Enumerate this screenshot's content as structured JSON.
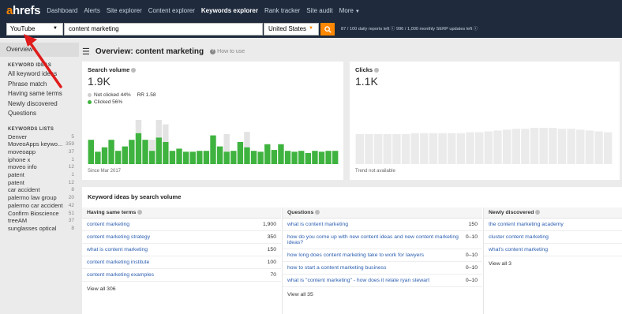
{
  "nav": {
    "logo_a": "a",
    "logo_rest": "hrefs",
    "items": [
      {
        "label": "Dashboard",
        "active": false
      },
      {
        "label": "Alerts",
        "active": false
      },
      {
        "label": "Site explorer",
        "active": false
      },
      {
        "label": "Content explorer",
        "active": false
      },
      {
        "label": "Keywords explorer",
        "active": true
      },
      {
        "label": "Rank tracker",
        "active": false
      },
      {
        "label": "Site audit",
        "active": false
      },
      {
        "label": "More",
        "active": false
      }
    ]
  },
  "search": {
    "source": "YouTube",
    "keyword": "content marketing",
    "country": "United States",
    "quota": "87 / 100 daily reports left ⓘ   996 / 1,000 monthly SERP updates left ⓘ"
  },
  "sidebar": {
    "overview_label": "Overview",
    "ideas_heading": "KEYWORD IDEAS",
    "ideas": [
      "All keyword ideas",
      "Phrase match",
      "Having same terms",
      "Newly discovered",
      "Questions"
    ],
    "lists_heading": "KEYWORDS LISTS",
    "lists": [
      {
        "name": "Denver",
        "count": "5"
      },
      {
        "name": "MoveoApps keywo...",
        "count": "359"
      },
      {
        "name": "moveoapp",
        "count": "37"
      },
      {
        "name": "iphone x",
        "count": "1"
      },
      {
        "name": "moveo info",
        "count": "12"
      },
      {
        "name": "patent",
        "count": "1"
      },
      {
        "name": "patent",
        "count": "12"
      },
      {
        "name": "car accident",
        "count": "8"
      },
      {
        "name": "palermo law group",
        "count": "20"
      },
      {
        "name": "palermo car accident",
        "count": "42"
      },
      {
        "name": "Confirm Bioscience",
        "count": "51"
      },
      {
        "name": "treeAM",
        "count": "37"
      },
      {
        "name": "sunglasses optical",
        "count": "8"
      }
    ]
  },
  "overview": {
    "title": "Overview: content marketing",
    "help": "How to use"
  },
  "search_volume": {
    "label": "Search volume",
    "value": "1.9K",
    "not_clicked": "Not clicked 44%",
    "rr": "RR 1.58",
    "clicked": "Clicked 56%",
    "since": "Since Mar 2017",
    "colors": {
      "clicked": "#3fb33f",
      "not_clicked": "#e3e3e3"
    }
  },
  "clicks": {
    "label": "Clicks",
    "value": "1.1K",
    "note": "Trend not available"
  },
  "chart_data": [
    {
      "type": "bar",
      "title": "Search volume",
      "series": [
        {
          "name": "Clicked",
          "values": [
            0.55,
            0.28,
            0.38,
            0.55,
            0.3,
            0.4,
            0.55,
            0.7,
            0.55,
            0.3,
            0.6,
            0.5,
            0.3,
            0.35,
            0.28,
            0.28,
            0.3,
            0.3,
            0.65,
            0.4,
            0.28,
            0.3,
            0.5,
            0.38,
            0.3,
            0.28,
            0.45,
            0.32,
            0.45,
            0.3,
            0.28,
            0.3,
            0.25,
            0.3,
            0.28,
            0.3,
            0.3
          ]
        },
        {
          "name": "Not clicked",
          "values": [
            0.0,
            0.0,
            0.0,
            0.0,
            0.0,
            0.0,
            0.0,
            0.3,
            0.0,
            0.25,
            0.4,
            0.4,
            0.0,
            0.0,
            0.0,
            0.0,
            0.0,
            0.0,
            0.0,
            0.0,
            0.4,
            0.0,
            0.0,
            0.35,
            0.0,
            0.0,
            0.0,
            0.0,
            0.0,
            0.0,
            0.0,
            0.0,
            0.0,
            0.0,
            0.0,
            0.0,
            0.0
          ]
        }
      ]
    },
    {
      "type": "bar",
      "title": "Clicks",
      "values": [
        0.68,
        0.68,
        0.68,
        0.68,
        0.68,
        0.68,
        0.7,
        0.7,
        0.7,
        0.7,
        0.7,
        0.7,
        0.72,
        0.72,
        0.74,
        0.76,
        0.78,
        0.8,
        0.8,
        0.82,
        0.82,
        0.82,
        0.8,
        0.8,
        0.78,
        0.76,
        0.74,
        0.72
      ]
    }
  ],
  "keyword_ideas": {
    "title": "Keyword ideas by search volume",
    "same_terms": {
      "header": "Having same terms",
      "rows": [
        {
          "term": "content marketing",
          "value": "1,900"
        },
        {
          "term": "content marketing strategy",
          "value": "350"
        },
        {
          "term": "what is content marketing",
          "value": "150"
        },
        {
          "term": "content marketing institute",
          "value": "100"
        },
        {
          "term": "content marketing examples",
          "value": "70"
        }
      ],
      "view_all": "View all 306"
    },
    "questions": {
      "header": "Questions",
      "rows": [
        {
          "term": "what is content marketing",
          "value": "150"
        },
        {
          "term": "how do you come up with new content ideas and new content marketing ideas?",
          "value": "0–10"
        },
        {
          "term": "how long does content marketing take to work for lawyers",
          "value": "0–10"
        },
        {
          "term": "how to start a content marketing business",
          "value": "0–10"
        },
        {
          "term": "what is \"content marketing\" - how does it relate ryan stewart",
          "value": "0–10"
        }
      ],
      "view_all": "View all 35"
    },
    "newly": {
      "header": "Newly discovered",
      "rows": [
        {
          "term": "the content marketing academy"
        },
        {
          "term": "cluster content marketing"
        },
        {
          "term": "what's content marketing"
        }
      ],
      "view_all": "View all 3"
    }
  }
}
